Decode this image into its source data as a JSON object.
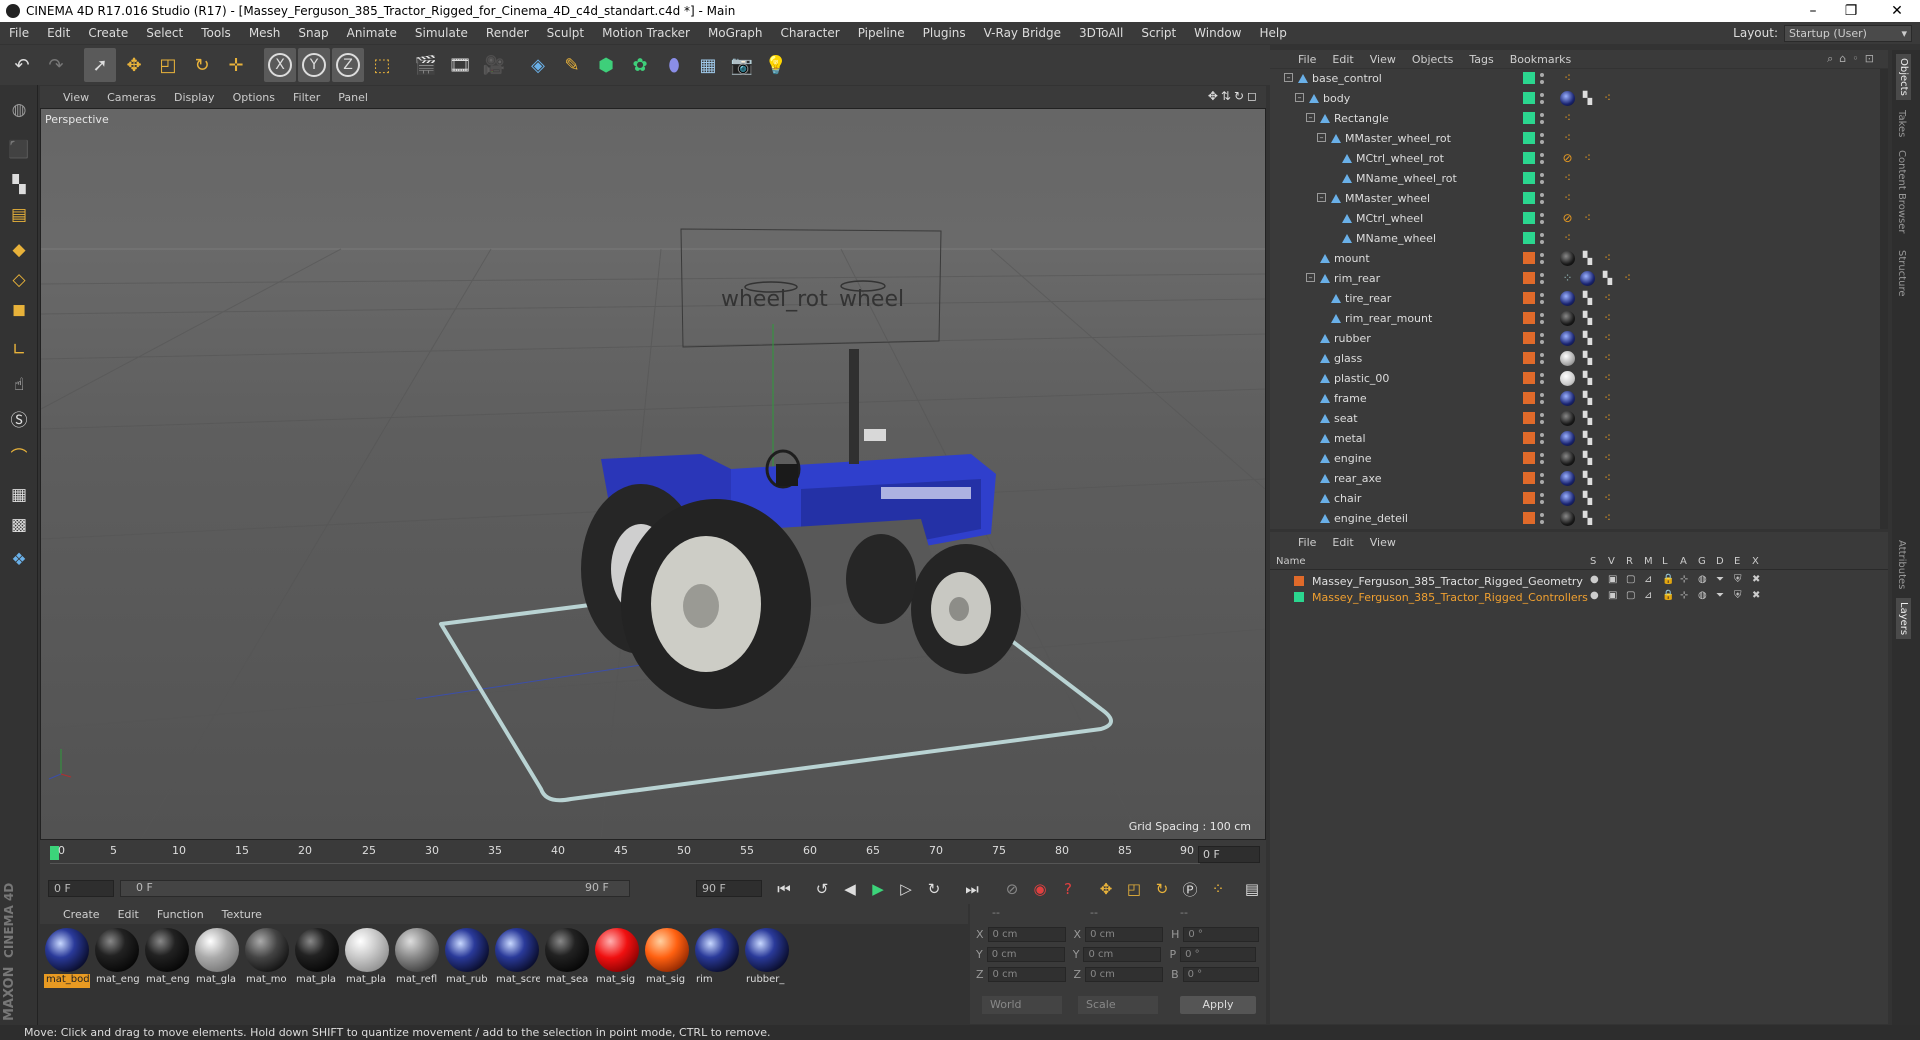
{
  "window": {
    "title": "CINEMA 4D R17.016 Studio (R17) - [Massey_Ferguson_385_Tractor_Rigged_for_Cinema_4D_c4d_standart.c4d *] - Main",
    "controls": [
      "–",
      "❐",
      "✕"
    ]
  },
  "menubar": {
    "items": [
      "File",
      "Edit",
      "Create",
      "Select",
      "Tools",
      "Mesh",
      "Snap",
      "Animate",
      "Simulate",
      "Render",
      "Sculpt",
      "Motion Tracker",
      "MoGraph",
      "Character",
      "Pipeline",
      "Plugins",
      "V-Ray Bridge",
      "3DToAll",
      "Script",
      "Window",
      "Help"
    ],
    "layout_label": "Layout:",
    "layout_value": "Startup (User)"
  },
  "toolbar": {
    "icons": [
      "undo-icon",
      "redo-icon",
      "select-arrow-icon",
      "move-icon",
      "scale-icon",
      "rotate-icon",
      "live-select-icon",
      "x-axis-icon",
      "y-axis-icon",
      "z-axis-icon",
      "world-coord-icon",
      "render-view-icon",
      "render-picture-queue-icon",
      "render-settings-icon",
      "cube-icon",
      "pen-icon",
      "subdivision-icon",
      "cloner-icon",
      "deformer-icon",
      "floor-icon",
      "camera-icon",
      "light-icon"
    ],
    "axis_labels": [
      "X",
      "Y",
      "Z"
    ]
  },
  "viewport": {
    "menu": [
      "View",
      "Cameras",
      "Display",
      "Options",
      "Filter",
      "Panel"
    ],
    "camera_label": "Perspective",
    "grid_spacing": "Grid Spacing : 100 cm",
    "controller_labels": [
      "wheel_rot",
      "wheel"
    ]
  },
  "timeline": {
    "ticks": [
      "0",
      "5",
      "10",
      "15",
      "20",
      "25",
      "30",
      "35",
      "40",
      "45",
      "50",
      "55",
      "60",
      "65",
      "70",
      "75",
      "80",
      "85",
      "90"
    ],
    "current_frame": "0 F",
    "start_field": "0 F",
    "range_start": "0 F",
    "range_end": "90 F",
    "end_field": "90 F"
  },
  "material_manager": {
    "menu": [
      "Create",
      "Edit",
      "Function",
      "Texture"
    ],
    "materials": [
      {
        "label": "mat_bod",
        "kind": "blue-logo",
        "selected": true
      },
      {
        "label": "mat_eng",
        "kind": "black"
      },
      {
        "label": "mat_eng",
        "kind": "black"
      },
      {
        "label": "mat_gla",
        "kind": "glass"
      },
      {
        "label": "mat_mo",
        "kind": "darkgray"
      },
      {
        "label": "mat_pla",
        "kind": "black"
      },
      {
        "label": "mat_pla",
        "kind": "lightgray"
      },
      {
        "label": "mat_refl",
        "kind": "gray"
      },
      {
        "label": "mat_rub",
        "kind": "blue-logo"
      },
      {
        "label": "mat_scre",
        "kind": "blue-logo"
      },
      {
        "label": "mat_sea",
        "kind": "black"
      },
      {
        "label": "mat_sig",
        "kind": "red"
      },
      {
        "label": "mat_sig",
        "kind": "orange"
      },
      {
        "label": "rim",
        "kind": "blue-logo"
      },
      {
        "label": "rubber_",
        "kind": "blue-logo"
      }
    ]
  },
  "coordinates": {
    "headers": [
      "--",
      "--",
      "--"
    ],
    "rows": [
      {
        "a": "X",
        "av": "0 cm",
        "b": "X",
        "bv": "0 cm",
        "c": "H",
        "cv": "0 °"
      },
      {
        "a": "Y",
        "av": "0 cm",
        "b": "Y",
        "bv": "0 cm",
        "c": "P",
        "cv": "0 °"
      },
      {
        "a": "Z",
        "av": "0 cm",
        "b": "Z",
        "bv": "0 cm",
        "c": "B",
        "cv": "0 °"
      }
    ],
    "mode1": "World",
    "mode2": "Scale",
    "apply": "Apply"
  },
  "object_manager": {
    "menu": [
      "File",
      "Edit",
      "View",
      "Objects",
      "Tags",
      "Bookmarks"
    ],
    "rows": [
      {
        "name": "base_control",
        "indent": 0,
        "box": "–",
        "layer": "#2bd68f",
        "tags": [
          "null-tag"
        ]
      },
      {
        "name": "body",
        "indent": 1,
        "box": "–",
        "layer": "#2bd68f",
        "tags": [
          "mat-blue",
          "checker",
          "null-tag"
        ]
      },
      {
        "name": "Rectangle",
        "indent": 2,
        "box": "–",
        "layer": "#2bd68f",
        "tags": [
          "null-tag"
        ]
      },
      {
        "name": "MMaster_wheel_rot",
        "indent": 3,
        "box": "–",
        "layer": "#2bd68f",
        "tags": [
          "null-tag"
        ]
      },
      {
        "name": "MCtrl_wheel_rot",
        "indent": 4,
        "box": "",
        "layer": "#2bd68f",
        "tags": [
          "forbidden",
          "null-tag"
        ]
      },
      {
        "name": "MName_wheel_rot",
        "indent": 4,
        "box": "",
        "layer": "#2bd68f",
        "tags": [
          "null-tag"
        ]
      },
      {
        "name": "MMaster_wheel",
        "indent": 3,
        "box": "–",
        "layer": "#2bd68f",
        "tags": [
          "null-tag"
        ]
      },
      {
        "name": "MCtrl_wheel",
        "indent": 4,
        "box": "",
        "layer": "#2bd68f",
        "tags": [
          "forbidden",
          "null-tag"
        ]
      },
      {
        "name": "MName_wheel",
        "indent": 4,
        "box": "",
        "layer": "#2bd68f",
        "tags": [
          "null-tag"
        ]
      },
      {
        "name": "mount",
        "indent": 2,
        "box": "",
        "layer": "#e06a2a",
        "tags": [
          "mat-dark",
          "checker",
          "null-tag"
        ]
      },
      {
        "name": "rim_rear",
        "indent": 2,
        "box": "–",
        "layer": "#e06a2a",
        "tags": [
          "dots",
          "mat-blue",
          "checker",
          "null-tag"
        ]
      },
      {
        "name": "tire_rear",
        "indent": 3,
        "box": "",
        "layer": "#e06a2a",
        "tags": [
          "mat-blue",
          "checker",
          "null-tag"
        ]
      },
      {
        "name": "rim_rear_mount",
        "indent": 3,
        "box": "",
        "layer": "#e06a2a",
        "tags": [
          "mat-dark",
          "checker",
          "null-tag"
        ]
      },
      {
        "name": "rubber",
        "indent": 2,
        "box": "",
        "layer": "#e06a2a",
        "tags": [
          "mat-blue",
          "checker",
          "null-tag"
        ]
      },
      {
        "name": "glass",
        "indent": 2,
        "box": "",
        "layer": "#e06a2a",
        "tags": [
          "mat-glass",
          "checker",
          "null-tag"
        ]
      },
      {
        "name": "plastic_00",
        "indent": 2,
        "box": "",
        "layer": "#e06a2a",
        "tags": [
          "mat-light",
          "checker",
          "null-tag"
        ]
      },
      {
        "name": "frame",
        "indent": 2,
        "box": "",
        "layer": "#e06a2a",
        "tags": [
          "mat-blue",
          "checker",
          "null-tag"
        ]
      },
      {
        "name": "seat",
        "indent": 2,
        "box": "",
        "layer": "#e06a2a",
        "tags": [
          "mat-dark",
          "checker",
          "null-tag"
        ]
      },
      {
        "name": "metal",
        "indent": 2,
        "box": "",
        "layer": "#e06a2a",
        "tags": [
          "mat-blue",
          "checker",
          "null-tag"
        ]
      },
      {
        "name": "engine",
        "indent": 2,
        "box": "",
        "layer": "#e06a2a",
        "tags": [
          "mat-dark",
          "checker",
          "null-tag"
        ]
      },
      {
        "name": "rear_axe",
        "indent": 2,
        "box": "",
        "layer": "#e06a2a",
        "tags": [
          "mat-blue",
          "checker",
          "null-tag"
        ]
      },
      {
        "name": "chair",
        "indent": 2,
        "box": "",
        "layer": "#e06a2a",
        "tags": [
          "mat-blue",
          "checker",
          "null-tag"
        ]
      },
      {
        "name": "engine_deteil",
        "indent": 2,
        "box": "",
        "layer": "#e06a2a",
        "tags": [
          "mat-dark",
          "checker",
          "null-tag"
        ]
      }
    ]
  },
  "layer_manager": {
    "menu": [
      "File",
      "Edit",
      "View"
    ],
    "column_name": "Name",
    "column_flags": [
      "S",
      "V",
      "R",
      "M",
      "L",
      "A",
      "G",
      "D",
      "E",
      "X"
    ],
    "layers": [
      {
        "name": "Massey_Ferguson_385_Tractor_Rigged_Geometry",
        "color": "#e06a2a",
        "text_color": "#e0e0e0"
      },
      {
        "name": "Massey_Ferguson_385_Tractor_Rigged_Controllers",
        "color": "#2bd68f",
        "text_color": "#f0a030"
      }
    ]
  },
  "right_tabs": [
    "Objects",
    "Takes",
    "Content Browser",
    "Structure",
    "Attributes",
    "Layers"
  ],
  "maxon": {
    "brand": "MAXON",
    "product": "CINEMA 4D"
  },
  "status": "Move: Click and drag to move elements. Hold down SHIFT to quantize movement / add to the selection in point mode, CTRL to remove."
}
